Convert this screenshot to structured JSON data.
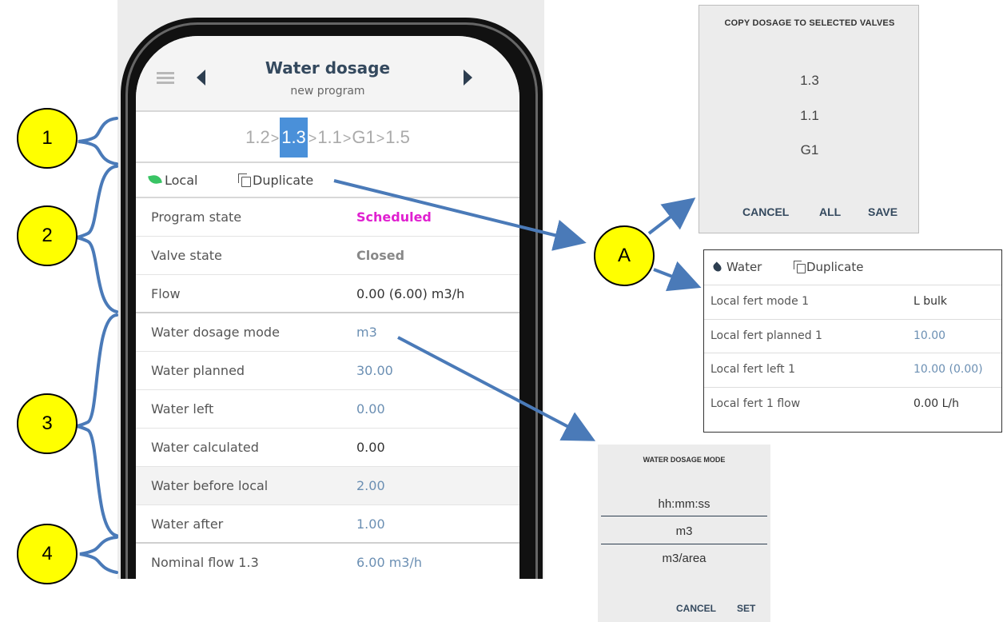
{
  "app": {
    "title": "Water dosage",
    "subtitle": "new program"
  },
  "breadcrumbs": {
    "items": [
      "1.2",
      "1.3",
      "1.1",
      "G1",
      "1.5"
    ],
    "separator": ">",
    "active_index": 1
  },
  "actions": {
    "local_label": "Local",
    "duplicate_label": "Duplicate"
  },
  "rows": [
    {
      "label": "Program state",
      "value": "Scheduled"
    },
    {
      "label": "Valve state",
      "value": "Closed"
    },
    {
      "label": "Flow",
      "value": "0.00 (6.00) m3/h"
    },
    {
      "label": "Water dosage mode",
      "value": "m3"
    },
    {
      "label": "Water planned",
      "value": "30.00"
    },
    {
      "label": "Water left",
      "value": "0.00"
    },
    {
      "label": "Water calculated",
      "value": "0.00"
    },
    {
      "label": "Water before local",
      "value": "2.00"
    },
    {
      "label": "Water after",
      "value": "1.00"
    },
    {
      "label": "Nominal flow 1.3",
      "value": "6.00 m3/h"
    }
  ],
  "callouts": {
    "one": "1",
    "two": "2",
    "three": "3",
    "four": "4",
    "a": "A"
  },
  "copy_dialog": {
    "title": "COPY DOSAGE TO SELECTED VALVES",
    "items": [
      "1.3",
      "1.1",
      "G1"
    ],
    "cancel": "CANCEL",
    "all": "ALL",
    "save": "SAVE"
  },
  "fert_panel": {
    "water_label": "Water",
    "duplicate_label": "Duplicate",
    "rows": [
      {
        "label": "Local fert mode 1",
        "value": "L bulk"
      },
      {
        "label": "Local fert planned 1",
        "value": "10.00"
      },
      {
        "label": "Local fert left 1",
        "value": "10.00 (0.00)"
      },
      {
        "label": "Local fert 1 flow",
        "value": "0.00 L/h"
      }
    ]
  },
  "mode_dialog": {
    "title": "WATER DOSAGE MODE",
    "options": [
      "hh:mm:ss",
      "m3",
      "m3/area"
    ],
    "selected": "m3",
    "cancel": "CANCEL",
    "set": "SET"
  },
  "colors": {
    "accent_blue": "#4a90d9",
    "scheduled_pink": "#e020d0",
    "callout_yellow": "#ffff00",
    "arrow_blue": "#4a7ab8",
    "leaf_green": "#39c464"
  },
  "icons": {
    "menu": "hamburger-icon",
    "prev": "triangle-left-icon",
    "next": "triangle-right-icon",
    "local": "leaf-icon",
    "duplicate": "copy-icon",
    "water": "water-drop-icon"
  }
}
